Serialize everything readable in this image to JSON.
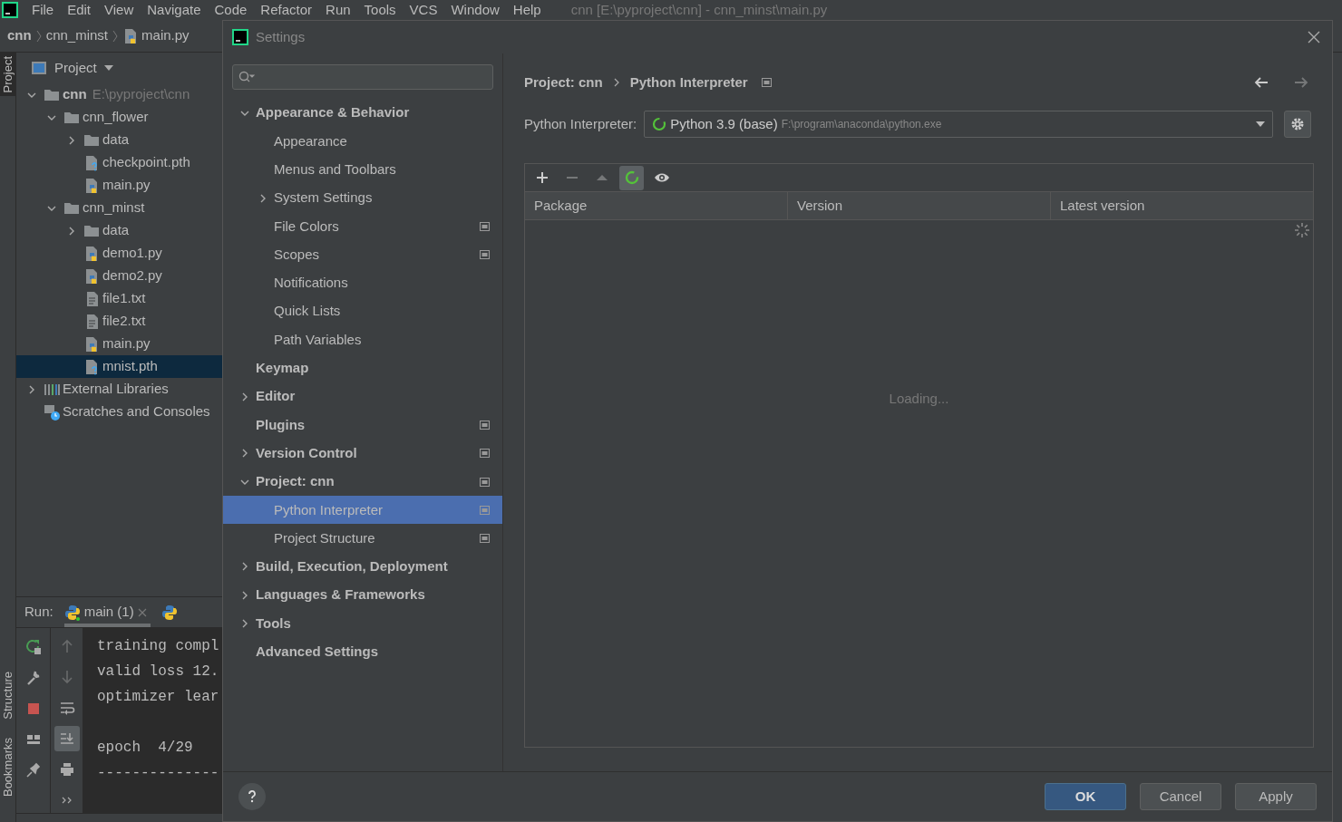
{
  "menu": [
    "File",
    "Edit",
    "View",
    "Navigate",
    "Code",
    "Refactor",
    "Run",
    "Tools",
    "VCS",
    "Window",
    "Help"
  ],
  "window_title": "cnn [E:\\pyproject\\cnn] - cnn_minst\\main.py",
  "breadcrumbs": [
    {
      "label": "cnn",
      "kind": "root"
    },
    {
      "label": "cnn_minst",
      "kind": "folder"
    },
    {
      "label": "main.py",
      "kind": "python"
    }
  ],
  "side_tabs_top": [
    {
      "label": "Project",
      "selected": true
    }
  ],
  "side_tabs_bottom": [
    {
      "label": "Structure",
      "selected": false
    },
    {
      "label": "Bookmarks",
      "selected": false
    }
  ],
  "project_panel": {
    "title": "Project",
    "tree": [
      {
        "label": "cnn",
        "path": "E:\\pyproject\\cnn",
        "kind": "folder",
        "expanded": true,
        "selected": false,
        "children": [
          {
            "label": "cnn_flower",
            "kind": "folder",
            "expanded": true,
            "selected": false,
            "children": [
              {
                "label": "data",
                "kind": "folder",
                "expanded": false,
                "selected": false
              },
              {
                "label": "checkpoint.pth",
                "kind": "unknown",
                "selected": false
              },
              {
                "label": "main.py",
                "kind": "python",
                "selected": false
              }
            ]
          },
          {
            "label": "cnn_minst",
            "kind": "folder",
            "expanded": true,
            "selected": false,
            "children": [
              {
                "label": "data",
                "kind": "folder",
                "expanded": false,
                "selected": false
              },
              {
                "label": "demo1.py",
                "kind": "python",
                "selected": false
              },
              {
                "label": "demo2.py",
                "kind": "python",
                "selected": false
              },
              {
                "label": "file1.txt",
                "kind": "text",
                "selected": false
              },
              {
                "label": "file2.txt",
                "kind": "text",
                "selected": false
              },
              {
                "label": "main.py",
                "kind": "python",
                "selected": false
              },
              {
                "label": "mnist.pth",
                "kind": "unknown",
                "selected": true
              }
            ]
          }
        ]
      },
      {
        "label": "External Libraries",
        "kind": "libraries",
        "expanded": false,
        "selected": false
      },
      {
        "label": "Scratches and Consoles",
        "kind": "scratches",
        "selected": false
      }
    ]
  },
  "run_panel": {
    "label": "Run:",
    "tabs": [
      {
        "label": "main (1)",
        "selected": true
      },
      {
        "selected": false
      }
    ],
    "tools_left": [
      {
        "kind": "rerun",
        "disabled": false
      },
      {
        "kind": "wrench",
        "disabled": false
      },
      {
        "kind": "stop",
        "disabled": false
      },
      {
        "kind": "layout",
        "disabled": false
      },
      {
        "kind": "pin",
        "disabled": false
      }
    ],
    "tools_right": [
      {
        "kind": "up",
        "disabled": true,
        "selected": false
      },
      {
        "kind": "down",
        "disabled": true,
        "selected": false
      },
      {
        "kind": "wrap",
        "disabled": false,
        "selected": false
      },
      {
        "kind": "scroll",
        "disabled": false,
        "selected": true
      },
      {
        "kind": "print",
        "disabled": false,
        "selected": false
      },
      {
        "kind": "more",
        "disabled": false,
        "selected": false
      }
    ],
    "console_blocks": [
      [
        "training compl",
        "valid loss 12.",
        "optimizer lear"
      ],
      [
        "epoch  4/29",
        "--------------"
      ]
    ]
  },
  "settings": {
    "title": "Settings",
    "tree": [
      {
        "label": "Appearance & Behavior",
        "expanded": true,
        "selected": false,
        "project_scoped": false,
        "children": [
          {
            "label": "Appearance",
            "selected": false,
            "project_scoped": false
          },
          {
            "label": "Menus and Toolbars",
            "selected": false,
            "project_scoped": false
          },
          {
            "label": "System Settings",
            "expanded": false,
            "selected": false,
            "project_scoped": false
          },
          {
            "label": "File Colors",
            "selected": false,
            "project_scoped": true
          },
          {
            "label": "Scopes",
            "selected": false,
            "project_scoped": true
          },
          {
            "label": "Notifications",
            "selected": false,
            "project_scoped": false
          },
          {
            "label": "Quick Lists",
            "selected": false,
            "project_scoped": false
          },
          {
            "label": "Path Variables",
            "selected": false,
            "project_scoped": false
          }
        ]
      },
      {
        "label": "Keymap",
        "selected": false,
        "project_scoped": false
      },
      {
        "label": "Editor",
        "expanded": false,
        "selected": false,
        "project_scoped": false
      },
      {
        "label": "Plugins",
        "selected": false,
        "project_scoped": true
      },
      {
        "label": "Version Control",
        "expanded": false,
        "selected": false,
        "project_scoped": true
      },
      {
        "label": "Project: cnn",
        "expanded": true,
        "selected": false,
        "project_scoped": true,
        "children": [
          {
            "label": "Python Interpreter",
            "selected": true,
            "project_scoped": true
          },
          {
            "label": "Project Structure",
            "selected": false,
            "project_scoped": true
          }
        ]
      },
      {
        "label": "Build, Execution, Deployment",
        "expanded": false,
        "selected": false,
        "project_scoped": false
      },
      {
        "label": "Languages & Frameworks",
        "expanded": false,
        "selected": false,
        "project_scoped": false
      },
      {
        "label": "Tools",
        "expanded": false,
        "selected": false,
        "project_scoped": false
      },
      {
        "label": "Advanced Settings",
        "selected": false,
        "project_scoped": false
      }
    ],
    "path": [
      "Project: cnn",
      "Python Interpreter"
    ],
    "nav": [
      {
        "kind": "back",
        "disabled": false
      },
      {
        "kind": "forward",
        "disabled": true
      }
    ],
    "interpreter": {
      "label": "Python Interpreter:",
      "name": "Python 3.9 (base)",
      "path": "F:\\program\\anaconda\\python.exe"
    },
    "package_tools": [
      {
        "kind": "add",
        "disabled": false,
        "selected": false
      },
      {
        "kind": "remove",
        "disabled": true,
        "selected": false
      },
      {
        "kind": "upgrade",
        "disabled": true,
        "selected": false
      },
      {
        "kind": "refresh",
        "disabled": false,
        "selected": true
      },
      {
        "kind": "eye",
        "disabled": false,
        "selected": false
      }
    ],
    "columns": [
      "Package",
      "Version",
      "Latest version"
    ],
    "status": "Loading...",
    "buttons": [
      {
        "label": "OK",
        "default": true
      },
      {
        "label": "Cancel",
        "default": false
      },
      {
        "label": "Apply",
        "default": false
      }
    ]
  }
}
